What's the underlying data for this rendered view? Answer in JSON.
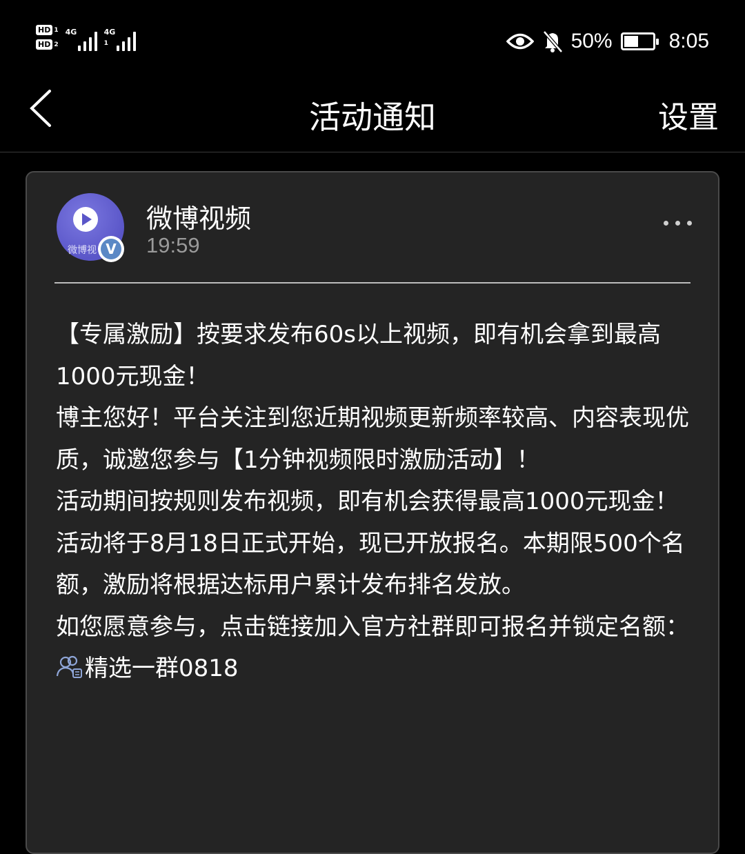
{
  "status_bar": {
    "hd1": "HD",
    "hd1_sub": "1",
    "hd2": "HD",
    "hd2_sub": "2",
    "net1": "4G",
    "net2": "4G",
    "net2_sub": "1",
    "battery": "50%",
    "time": "8:05",
    "battery_level": 0.5,
    "icons": [
      "eye-icon",
      "bell-off-icon",
      "battery-charging-icon"
    ]
  },
  "header": {
    "title": "活动通知",
    "settings_label": "设置"
  },
  "message": {
    "sender": "微博视频",
    "avatar_text": "微博视",
    "verified_mark": "V",
    "time": "19:59",
    "paragraphs": [
      "【专属激励】按要求发布60s以上视频，即有机会拿到最高1000元现金！",
      "博主您好！平台关注到您近期视频更新频率较高、内容表现优质，诚邀您参与【1分钟视频限时激励活动】！",
      "活动期间按规则发布视频，即有机会获得最高1000元现金！",
      "活动将于8月18日正式开始，现已开放报名。本期限500个名额，激励将根据达标用户累计发布排名发放。"
    ],
    "last_paragraph_prefix": "如您愿意参与，点击链接加入官方社群即可报名并锁定名额：",
    "group_link": "精选一群0818"
  },
  "colors": {
    "background": "#000000",
    "card": "#242424",
    "muted_text": "#9a9a9a",
    "avatar_purple": "#5a56c8",
    "verified_blue": "#5b88c5"
  }
}
